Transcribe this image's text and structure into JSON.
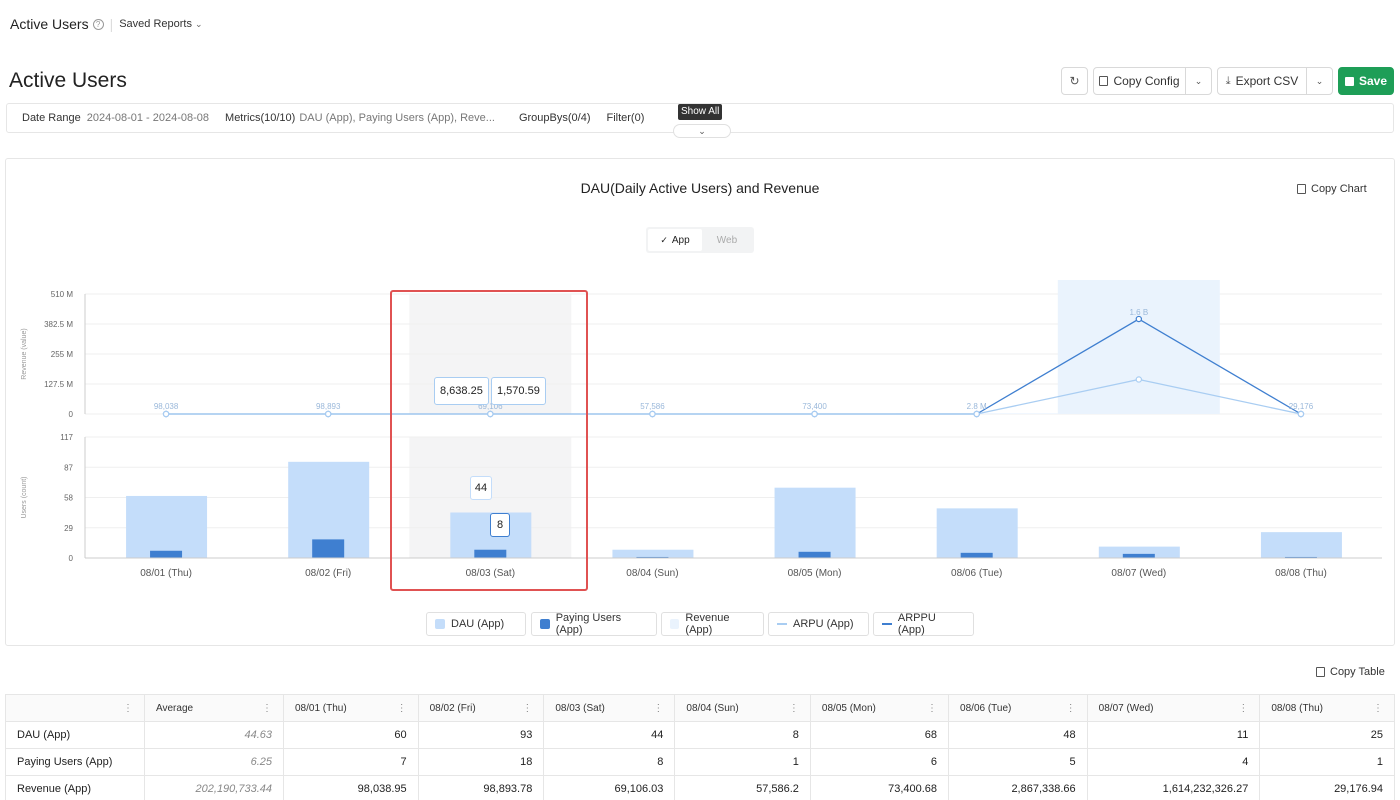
{
  "topbar": {
    "title": "Active Users",
    "saved_reports": "Saved Reports"
  },
  "page": {
    "title": "Active Users"
  },
  "toolbar": {
    "copy_config": "Copy Config",
    "export_csv": "Export CSV",
    "save": "Save"
  },
  "filters": {
    "date_range_label": "Date Range",
    "date_range_value": "2024-08-01 - 2024-08-08",
    "metrics_label": "Metrics(10/10)",
    "metrics_value": "DAU (App), Paying Users (App), Reve...",
    "groupbys_label": "GroupBys(0/4)",
    "filter_label": "Filter(0)",
    "show_all_tooltip": "Show All"
  },
  "chart": {
    "title": "DAU(Daily Active Users) and Revenue",
    "copy_chart": "Copy Chart",
    "toggle": {
      "app": "App",
      "web": "Web",
      "selected": "App"
    },
    "legend": [
      "DAU (App)",
      "Paying Users (App)",
      "Revenue (App)",
      "ARPU (App)",
      "ARPPU (App)"
    ],
    "tooltips": {
      "arpu": "8,638.25",
      "arppu": "1,570.59",
      "dau": "44",
      "paying": "8"
    }
  },
  "chart_data": {
    "type": "bar",
    "title": "DAU(Daily Active Users) and Revenue",
    "categories": [
      "08/01 (Thu)",
      "08/02 (Fri)",
      "08/03 (Sat)",
      "08/04 (Sun)",
      "08/05 (Mon)",
      "08/06 (Tue)",
      "08/07 (Wed)",
      "08/08 (Thu)"
    ],
    "top_panel": {
      "ylabel": "Revenue (value)",
      "ylim": [
        0,
        510000000
      ],
      "yticks": [
        "510 M",
        "382.5 M",
        "255 M",
        "127.5 M",
        "0"
      ],
      "revenue_point_labels": [
        "98,038",
        "98,893",
        "69,106",
        "57,586",
        "73,400",
        "2.8 M",
        "1.6 B",
        "29,176"
      ],
      "series": [
        {
          "name": "Revenue (App)",
          "values": [
            98038.95,
            98893.78,
            69106.03,
            57586.2,
            73400.68,
            2867338.66,
            1614232326.27,
            29176.94
          ]
        },
        {
          "name": "ARPU (App)",
          "values": [
            0,
            0,
            0,
            0,
            0,
            0,
            146748393,
            0
          ]
        },
        {
          "name": "ARPPU (App)",
          "values": [
            0,
            0,
            0,
            0,
            0,
            0,
            403558081,
            0
          ]
        }
      ]
    },
    "bottom_panel": {
      "ylabel": "Users (count)",
      "ylim": [
        0,
        117
      ],
      "yticks": [
        "117",
        "87",
        "58",
        "29",
        "0"
      ],
      "series": [
        {
          "name": "DAU (App)",
          "values": [
            60,
            93,
            44,
            8,
            68,
            48,
            11,
            25
          ]
        },
        {
          "name": "Paying Users (App)",
          "values": [
            7,
            18,
            8,
            1,
            6,
            5,
            4,
            1
          ]
        }
      ]
    },
    "highlighted_category": "08/03 (Sat)"
  },
  "table": {
    "copy_table": "Copy Table",
    "headers": [
      "Average",
      "08/01 (Thu)",
      "08/02 (Fri)",
      "08/03 (Sat)",
      "08/04 (Sun)",
      "08/05 (Mon)",
      "08/06 (Tue)",
      "08/07 (Wed)",
      "08/08 (Thu)"
    ],
    "rows": [
      {
        "name": "DAU (App)",
        "avg": "44.63",
        "cells": [
          "60",
          "93",
          "44",
          "8",
          "68",
          "48",
          "11",
          "25"
        ]
      },
      {
        "name": "Paying Users (App)",
        "avg": "6.25",
        "cells": [
          "7",
          "18",
          "8",
          "1",
          "6",
          "5",
          "4",
          "1"
        ]
      },
      {
        "name": "Revenue (App)",
        "avg": "202,190,733.44",
        "cells": [
          "98,038.95",
          "98,893.78",
          "69,106.03",
          "57,586.2",
          "73,400.68",
          "2,867,338.66",
          "1,614,232,326.27",
          "29,176.94"
        ]
      }
    ]
  },
  "colors": {
    "dau": "#c4ddfa",
    "paying": "#3f7fd0",
    "revenue_band": "#eaf3fd",
    "arpu": "#a9cdf2",
    "arppu": "#3f7fd0",
    "highlight_border": "#e05252",
    "save_green": "#1e9e57"
  }
}
